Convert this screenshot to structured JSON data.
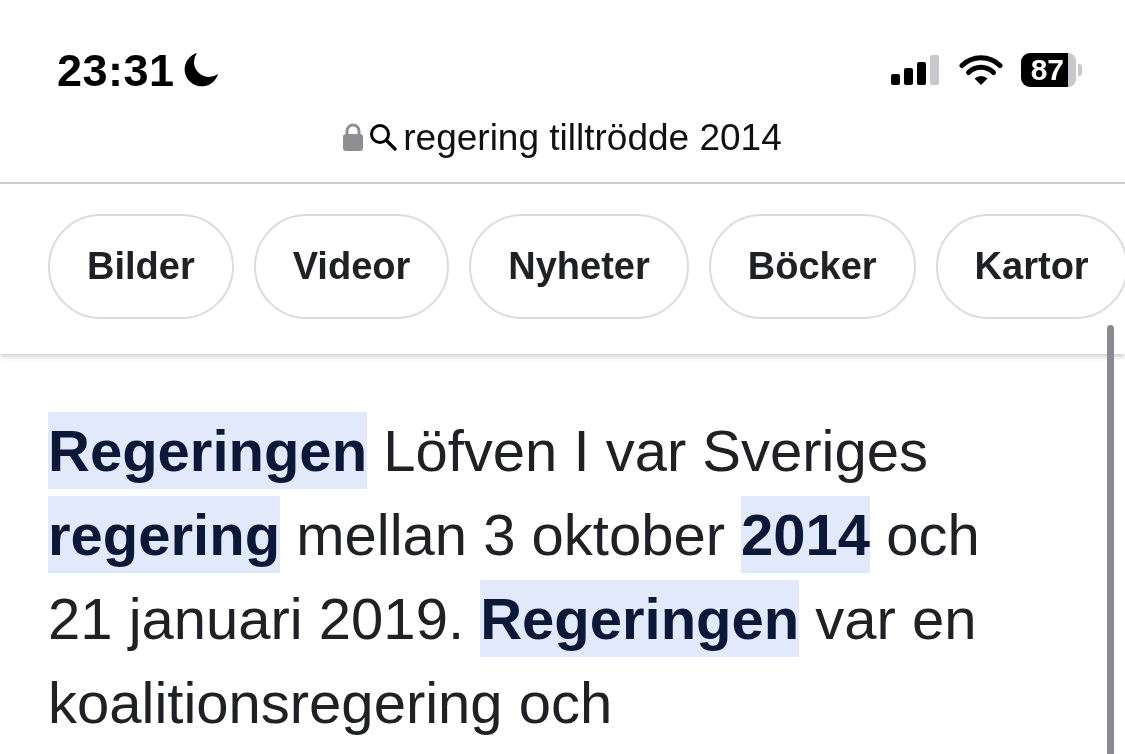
{
  "status_bar": {
    "time": "23:31",
    "battery": "87"
  },
  "address_bar": {
    "query": "regering tilltrödde 2014"
  },
  "filter_chips": [
    {
      "label": "Bilder",
      "selected": false
    },
    {
      "label": "Videor",
      "selected": false
    },
    {
      "label": "Nyheter",
      "selected": false
    },
    {
      "label": "Böcker",
      "selected": false
    },
    {
      "label": "Kartor",
      "selected": false
    }
  ],
  "snippet": {
    "text": "**Regeringen** Löfven I var Sveriges **regering** mellan 3 oktober **2014** och 21 januari 2019. **Regeringen** var en koalitionsregering och"
  }
}
